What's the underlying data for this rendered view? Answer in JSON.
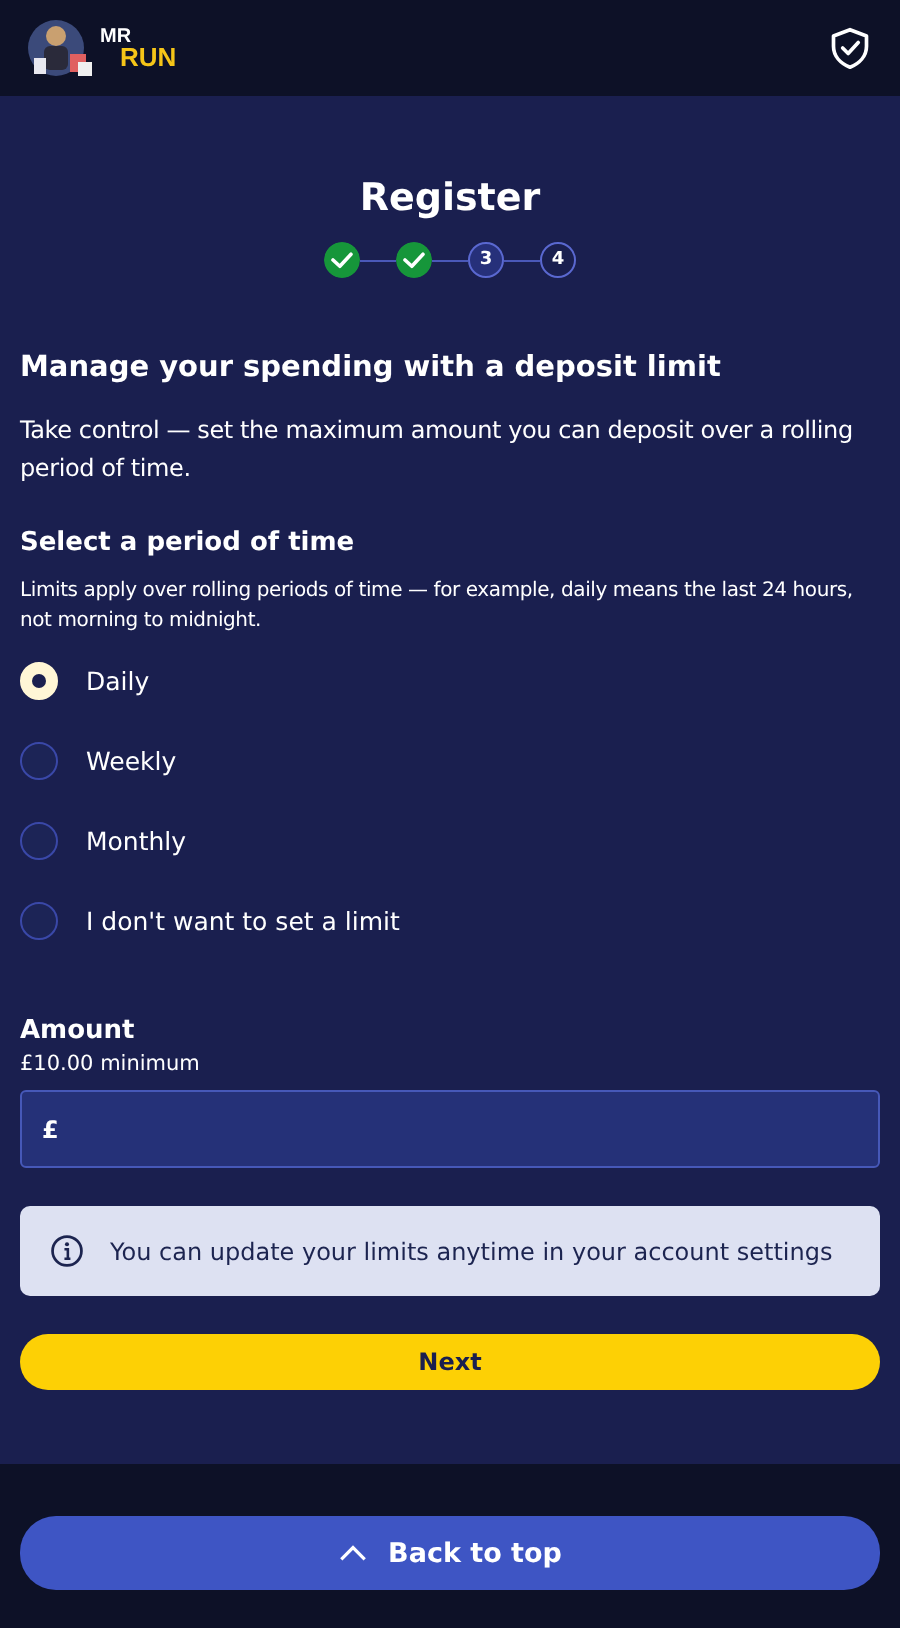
{
  "header": {
    "logo_top": "MR",
    "logo_bottom": "RUN"
  },
  "title": "Register",
  "steps": [
    {
      "kind": "done"
    },
    {
      "kind": "done"
    },
    {
      "kind": "number",
      "label": "3",
      "selected": true
    },
    {
      "kind": "number",
      "label": "4",
      "selected": false
    }
  ],
  "heading": "Manage your spending with a deposit limit",
  "intro": "Take control — set the maximum amount you can deposit over a rolling period of time.",
  "period": {
    "label": "Select a period of time",
    "hint": "Limits apply over rolling periods of time — for example, daily means the last 24 hours, not morning to midnight.",
    "options": [
      {
        "label": "Daily",
        "selected": true
      },
      {
        "label": "Weekly",
        "selected": false
      },
      {
        "label": "Monthly",
        "selected": false
      },
      {
        "label": "I don't want to set a limit",
        "selected": false
      }
    ]
  },
  "amount": {
    "label": "Amount",
    "hint": "£10.00 minimum",
    "prefix": "£"
  },
  "info": "You can update your limits anytime in your account settings",
  "next_button": "Next",
  "back_to_top": "Back to top"
}
